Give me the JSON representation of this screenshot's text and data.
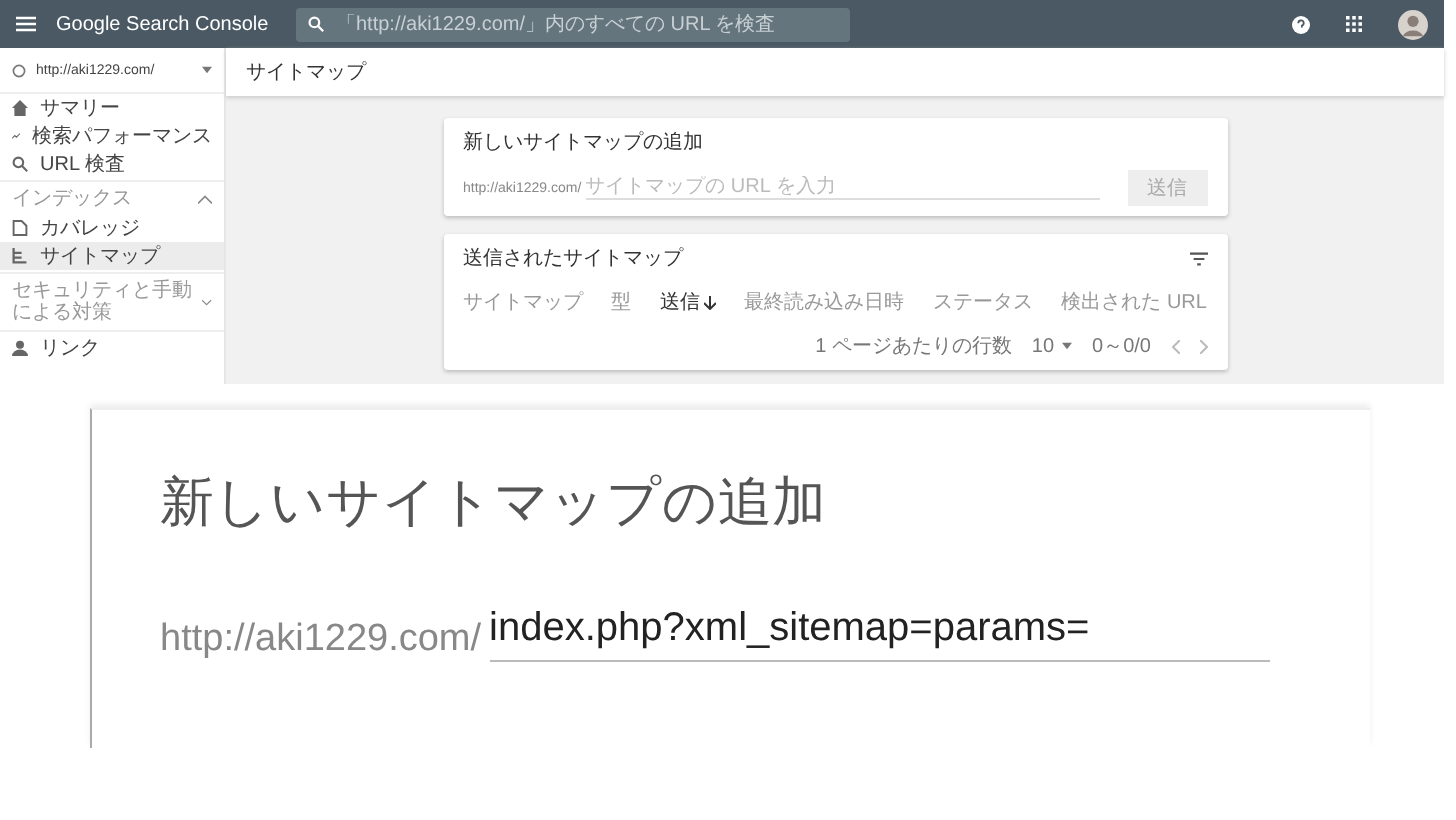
{
  "header": {
    "title": "Google Search Console",
    "search_placeholder": "「http://aki1229.com/」内のすべての URL を検査"
  },
  "sidebar": {
    "property": "http://aki1229.com/",
    "items": [
      {
        "label": "サマリー",
        "selected": false
      },
      {
        "label": "検索パフォーマンス",
        "selected": false
      },
      {
        "label": "URL 検査",
        "selected": false
      }
    ],
    "sections": [
      {
        "label": "インデックス",
        "expanded": true,
        "items": [
          {
            "label": "カバレッジ",
            "selected": false
          },
          {
            "label": "サイトマップ",
            "selected": true
          }
        ]
      },
      {
        "label": "セキュリティと手動による対策",
        "expanded": false
      }
    ],
    "bottom_items": [
      {
        "label": "リンク",
        "selected": false
      }
    ]
  },
  "page_title": "サイトマップ",
  "add_card": {
    "title": "新しいサイトマップの追加",
    "prefix": "http://aki1229.com/",
    "placeholder": "サイトマップの URL を入力",
    "button": {
      "label": "送信",
      "disabled": true
    }
  },
  "submitted_card": {
    "title": "送信されたサイトマップ",
    "columns": [
      {
        "label": "サイトマップ",
        "sorted": false
      },
      {
        "label": "型",
        "sorted": false
      },
      {
        "label": "送信",
        "sorted": true
      },
      {
        "label": "最終読み込み日時",
        "sorted": false
      },
      {
        "label": "ステータス",
        "sorted": false
      },
      {
        "label": "検出された URL",
        "sorted": false
      }
    ],
    "rows_per_page_label": "1 ページあたりの行数",
    "rows_per_page": "10",
    "range": "0～0/0"
  },
  "zoom_inset": {
    "title": "新しいサイトマップの追加",
    "prefix": "http://aki1229.com/",
    "value": "index.php?xml_sitemap=params="
  }
}
